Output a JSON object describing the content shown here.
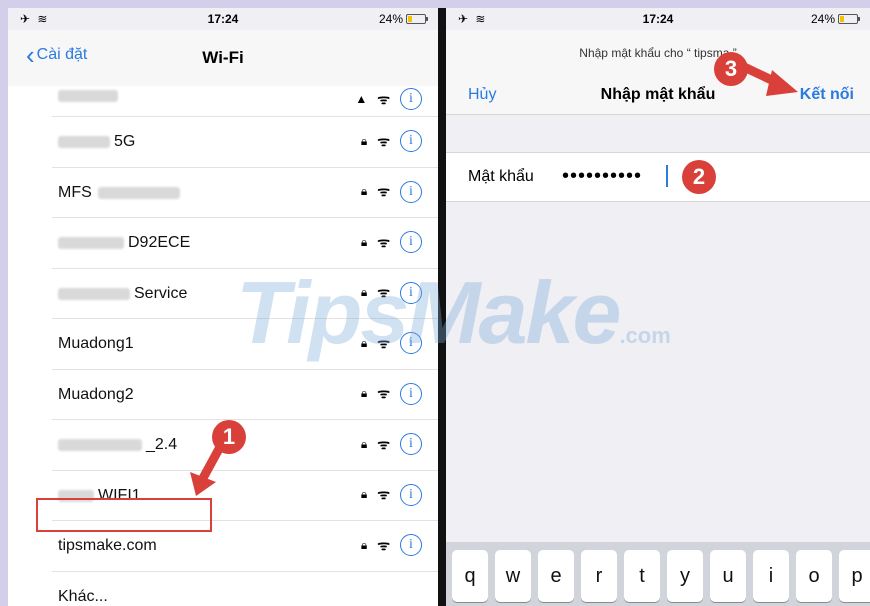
{
  "left": {
    "status": {
      "time": "17:24",
      "battery": "24%"
    },
    "nav": {
      "back_label": "Cài đặt",
      "title": "Wi-Fi"
    },
    "networks": [
      {
        "name": ""
      },
      {
        "name": "5G"
      },
      {
        "name": "MFS"
      },
      {
        "name": "D92ECE"
      },
      {
        "name": "Service"
      },
      {
        "name": "Muadong1"
      },
      {
        "name": "Muadong2"
      },
      {
        "name": "_2.4"
      },
      {
        "name": "WIFI1"
      },
      {
        "name": "tipsmake.com"
      }
    ],
    "other_label": "Khác..."
  },
  "right": {
    "status": {
      "time": "17:24",
      "battery": "24%"
    },
    "prompt": "Nhập mật khẩu cho “ tipsma ”",
    "cancel_label": "Hủy",
    "title": "Nhập mật khẩu",
    "connect_label": "Kết nối",
    "password_label": "Mật khẩu",
    "password_mask": "••••••••••",
    "keys": [
      "q",
      "w",
      "e",
      "r",
      "t",
      "y",
      "u",
      "i",
      "o",
      "p"
    ]
  },
  "annotations": {
    "step1": "1",
    "step2": "2",
    "step3": "3"
  },
  "watermark": {
    "text": "TipsMake",
    "suffix": ".com"
  },
  "colors": {
    "accent": "#2b7ae0",
    "annotation": "#d9403a",
    "frame": "#d3ceea"
  },
  "icons": {
    "lock": "lock-icon",
    "wifi": "wifi-icon",
    "info": "info-icon",
    "airplane": "airplane-icon"
  }
}
